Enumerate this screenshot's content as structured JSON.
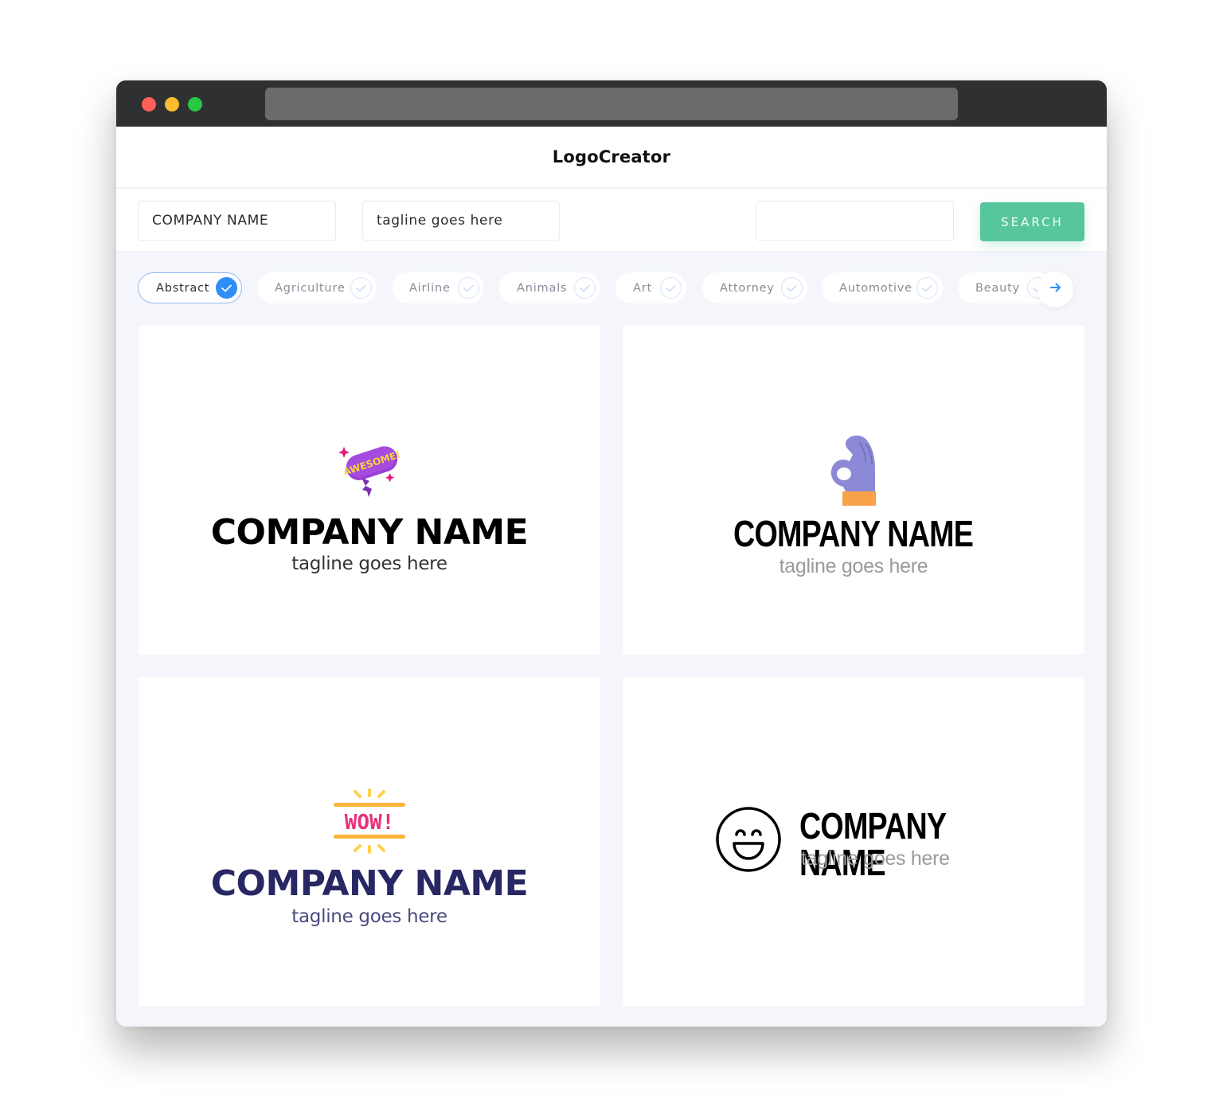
{
  "window": {
    "controls": [
      "close",
      "minimize",
      "maximize"
    ],
    "url": ""
  },
  "header": {
    "title": "LogoCreator"
  },
  "toolbar": {
    "company_value": "COMPANY NAME",
    "tagline_value": "tagline goes here",
    "search_value": "",
    "search_label": "SEARCH"
  },
  "categories": [
    {
      "label": "Abstract",
      "selected": true
    },
    {
      "label": "Agriculture",
      "selected": false
    },
    {
      "label": "Airline",
      "selected": false
    },
    {
      "label": "Animals",
      "selected": false
    },
    {
      "label": "Art",
      "selected": false
    },
    {
      "label": "Attorney",
      "selected": false
    },
    {
      "label": "Automotive",
      "selected": false
    },
    {
      "label": "Beauty",
      "selected": false
    }
  ],
  "next_icon": "arrow-right-icon",
  "logos": [
    {
      "icon": "awesome-speech-bubble-icon",
      "icon_text": "AWESOME!",
      "company": "COMPANY NAME",
      "tagline": "tagline goes here",
      "name_color": "#000000",
      "tag_color": "#333333"
    },
    {
      "icon": "ok-hand-icon",
      "company": "COMPANY NAME",
      "tagline": "tagline goes here",
      "name_color": "#000000",
      "tag_color": "#9a9a9a"
    },
    {
      "icon": "wow-sign-icon",
      "icon_text": "WOW!",
      "company": "COMPANY NAME",
      "tagline": "tagline goes here",
      "name_color": "#272764",
      "tag_color": "#4a4a7e"
    },
    {
      "icon": "laughing-face-icon",
      "company": "COMPANY NAME",
      "tagline": "tagline goes here",
      "name_color": "#000000",
      "tag_color": "#9a9a9a"
    }
  ],
  "colors": {
    "accent_green": "#58c69d",
    "accent_blue": "#2f8ef5",
    "titlebar": "#2f3032"
  }
}
